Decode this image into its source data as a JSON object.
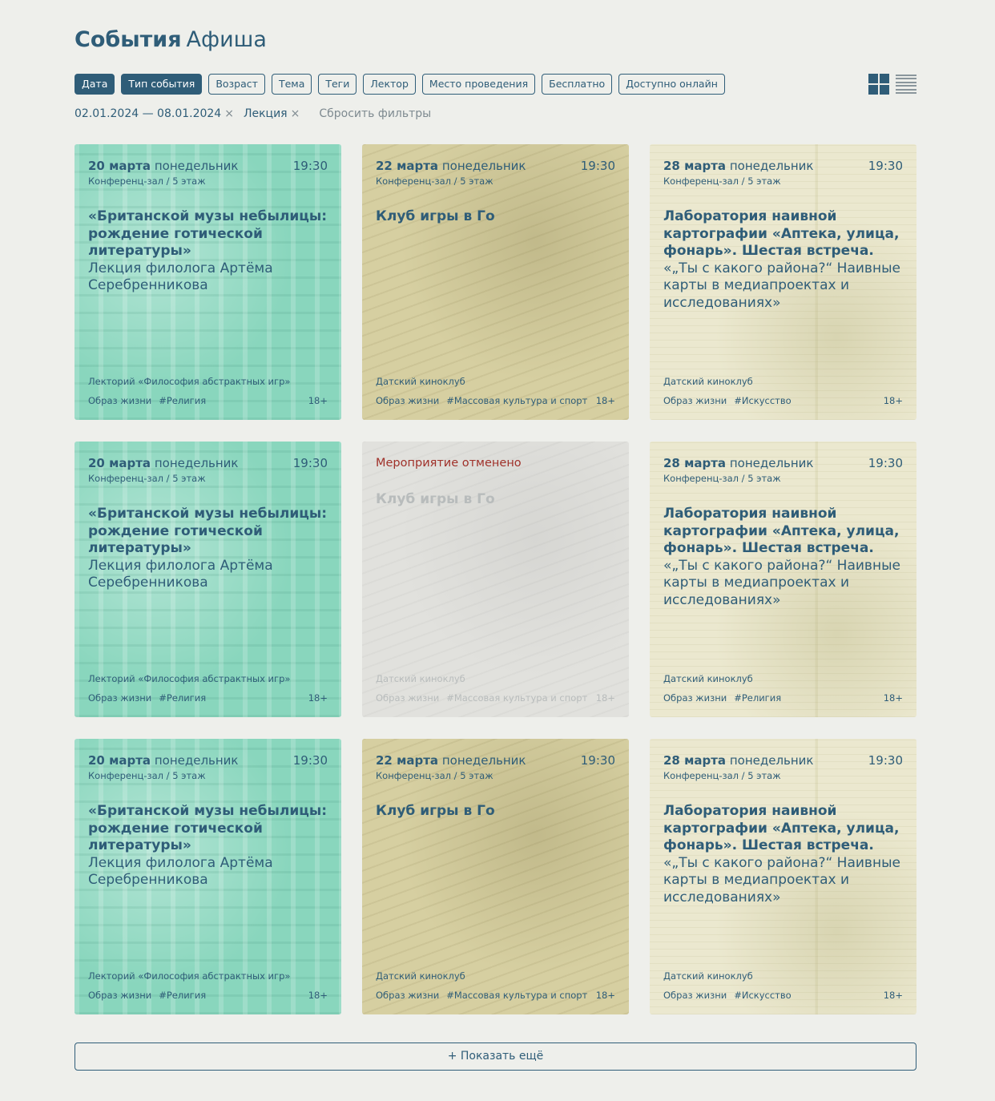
{
  "header": {
    "title_bold": "События",
    "title_light": "Афиша"
  },
  "filters": [
    {
      "label": "Дата",
      "active": true
    },
    {
      "label": "Тип события",
      "active": true
    },
    {
      "label": "Возраст",
      "active": false
    },
    {
      "label": "Тема",
      "active": false
    },
    {
      "label": "Теги",
      "active": false
    },
    {
      "label": "Лектор",
      "active": false
    },
    {
      "label": "Место проведения",
      "active": false
    },
    {
      "label": "Бесплатно",
      "active": false
    },
    {
      "label": "Доступно онлайн",
      "active": false
    }
  ],
  "view_toggle": {
    "grid_icon": "grid-view-icon",
    "list_icon": "list-view-icon",
    "selected": "grid"
  },
  "active_filters": {
    "items": [
      {
        "label": "02.01.2024 — 08.01.2024",
        "remove": "×"
      },
      {
        "label": "Лекция",
        "remove": "×"
      }
    ],
    "reset_label": "Сбросить фильтры"
  },
  "cards": [
    {
      "style": "green",
      "date_day": "20 марта",
      "weekday": "понедельник",
      "time": "19:30",
      "place": "Конференц-зал / 5 этаж",
      "title": "«Британской музы небылицы: рождение готической литературы»",
      "subtitle": "Лекция филолога Артёма Серебренникова",
      "series": "Лекторий «Философия абстрактных игр»",
      "tags": [
        "Образ жизни",
        "#Религия"
      ],
      "age": "18+"
    },
    {
      "style": "olive",
      "date_day": "22 марта",
      "weekday": "понедельник",
      "time": "19:30",
      "place": "Конференц-зал / 5 этаж",
      "title": "Клуб игры в Го",
      "subtitle": "",
      "series": "Датский киноклуб",
      "tags": [
        "Образ жизни",
        "#Массовая культура и спорт"
      ],
      "age": "18+"
    },
    {
      "style": "cream",
      "date_day": "28 марта",
      "weekday": "понедельник",
      "time": "19:30",
      "place": "Конференц-зал / 5 этаж",
      "title": "Лаборатория наивной картографии «Аптека, улица, фонарь». Шестая встреча.",
      "subtitle": "«„Ты с какого района?“ Наивные карты в медиапроектах и исследованиях»",
      "series": "Датский киноклуб",
      "tags": [
        "Образ жизни",
        "#Искусство"
      ],
      "age": "18+"
    },
    {
      "style": "green",
      "date_day": "20 марта",
      "weekday": "понедельник",
      "time": "19:30",
      "place": "Конференц-зал / 5 этаж",
      "title": "«Британской музы небылицы: рождение готической литературы»",
      "subtitle": "Лекция филолога Артёма Серебренникова",
      "series": "Лекторий «Философия абстрактных игр»",
      "tags": [
        "Образ жизни",
        "#Религия"
      ],
      "age": "18+"
    },
    {
      "style": "cancel",
      "cancelled_label": "Мероприятие отменено",
      "title": "Клуб игры в Го",
      "subtitle": "",
      "series": "Датский киноклуб",
      "tags": [
        "Образ жизни",
        "#Массовая культура и спорт"
      ],
      "age": "18+"
    },
    {
      "style": "cream",
      "date_day": "28 марта",
      "weekday": "понедельник",
      "time": "19:30",
      "place": "Конференц-зал / 5 этаж",
      "title": "Лаборатория наивной картографии «Аптека, улица, фонарь». Шестая встреча.",
      "subtitle": "«„Ты с какого района?“ Наивные карты в медиапроектах и исследованиях»",
      "series": "Датский киноклуб",
      "tags": [
        "Образ жизни",
        "#Религия"
      ],
      "age": "18+"
    },
    {
      "style": "green",
      "date_day": "20 марта",
      "weekday": "понедельник",
      "time": "19:30",
      "place": "Конференц-зал / 5 этаж",
      "title": "«Британской музы небылицы: рождение готической литературы»",
      "subtitle": "Лекция филолога Артёма Серебренникова",
      "series": "Лекторий «Философия абстрактных игр»",
      "tags": [
        "Образ жизни",
        "#Религия"
      ],
      "age": "18+"
    },
    {
      "style": "olive",
      "date_day": "22 марта",
      "weekday": "понедельник",
      "time": "19:30",
      "place": "Конференц-зал / 5 этаж",
      "title": "Клуб игры в Го",
      "subtitle": "",
      "series": "Датский киноклуб",
      "tags": [
        "Образ жизни",
        "#Массовая культура и спорт"
      ],
      "age": "18+"
    },
    {
      "style": "cream",
      "date_day": "28 марта",
      "weekday": "понедельник",
      "time": "19:30",
      "place": "Конференц-зал / 5 этаж",
      "title": "Лаборатория наивной картографии «Аптека, улица, фонарь». Шестая встреча.",
      "subtitle": "«„Ты с какого района?“ Наивные карты в медиапроектах и исследованиях»",
      "series": "Датский киноклуб",
      "tags": [
        "Образ жизни",
        "#Искусство"
      ],
      "age": "18+"
    }
  ],
  "more_button": {
    "label": "+ Показать ещё"
  },
  "colors": {
    "accent": "#2f5d78",
    "background": "#eeefeb",
    "cancelled": "#a0312a",
    "muted": "#7e8a90"
  }
}
